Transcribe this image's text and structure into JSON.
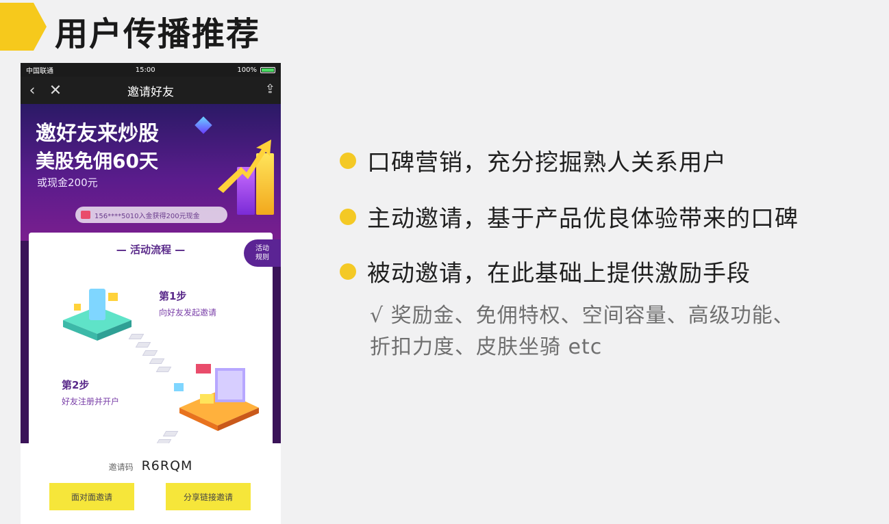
{
  "slide": {
    "title": "用户传播推荐",
    "accent_color": "#f6c91c"
  },
  "phone": {
    "status_bar": {
      "carrier": "中国联通",
      "time": "15:00",
      "battery": "100%"
    },
    "nav": {
      "back_icon": "chevron-left-icon",
      "close_icon": "close-icon",
      "title": "邀请好友",
      "share_icon": "share-icon"
    },
    "banner": {
      "headline1": "邀好友来炒股",
      "headline2": "美股免佣60天",
      "headline3": "或现金200元",
      "reward_ticker": "156****5010入金获得200元现金"
    },
    "card": {
      "flow_title": "— 活动流程 —",
      "rules_tab": "活动\n规则",
      "step1_title": "第1步",
      "step1_desc": "向好友发起邀请",
      "step2_title": "第2步",
      "step2_desc": "好友注册并开户"
    },
    "bottom": {
      "code_label": "邀请码",
      "code_value": "R6RQM",
      "btn_face_to_face": "面对面邀请",
      "btn_share_link": "分享链接邀请"
    }
  },
  "bullets": [
    "口碑营销，充分挖掘熟人关系用户",
    "主动邀请，基于产品优良体验带来的口碑",
    "被动邀请，在此基础上提供激励手段"
  ],
  "sub_points": [
    "√ 奖励金、免佣特权、空间容量、高级功能、",
    "折扣力度、皮肤坐骑 etc"
  ]
}
